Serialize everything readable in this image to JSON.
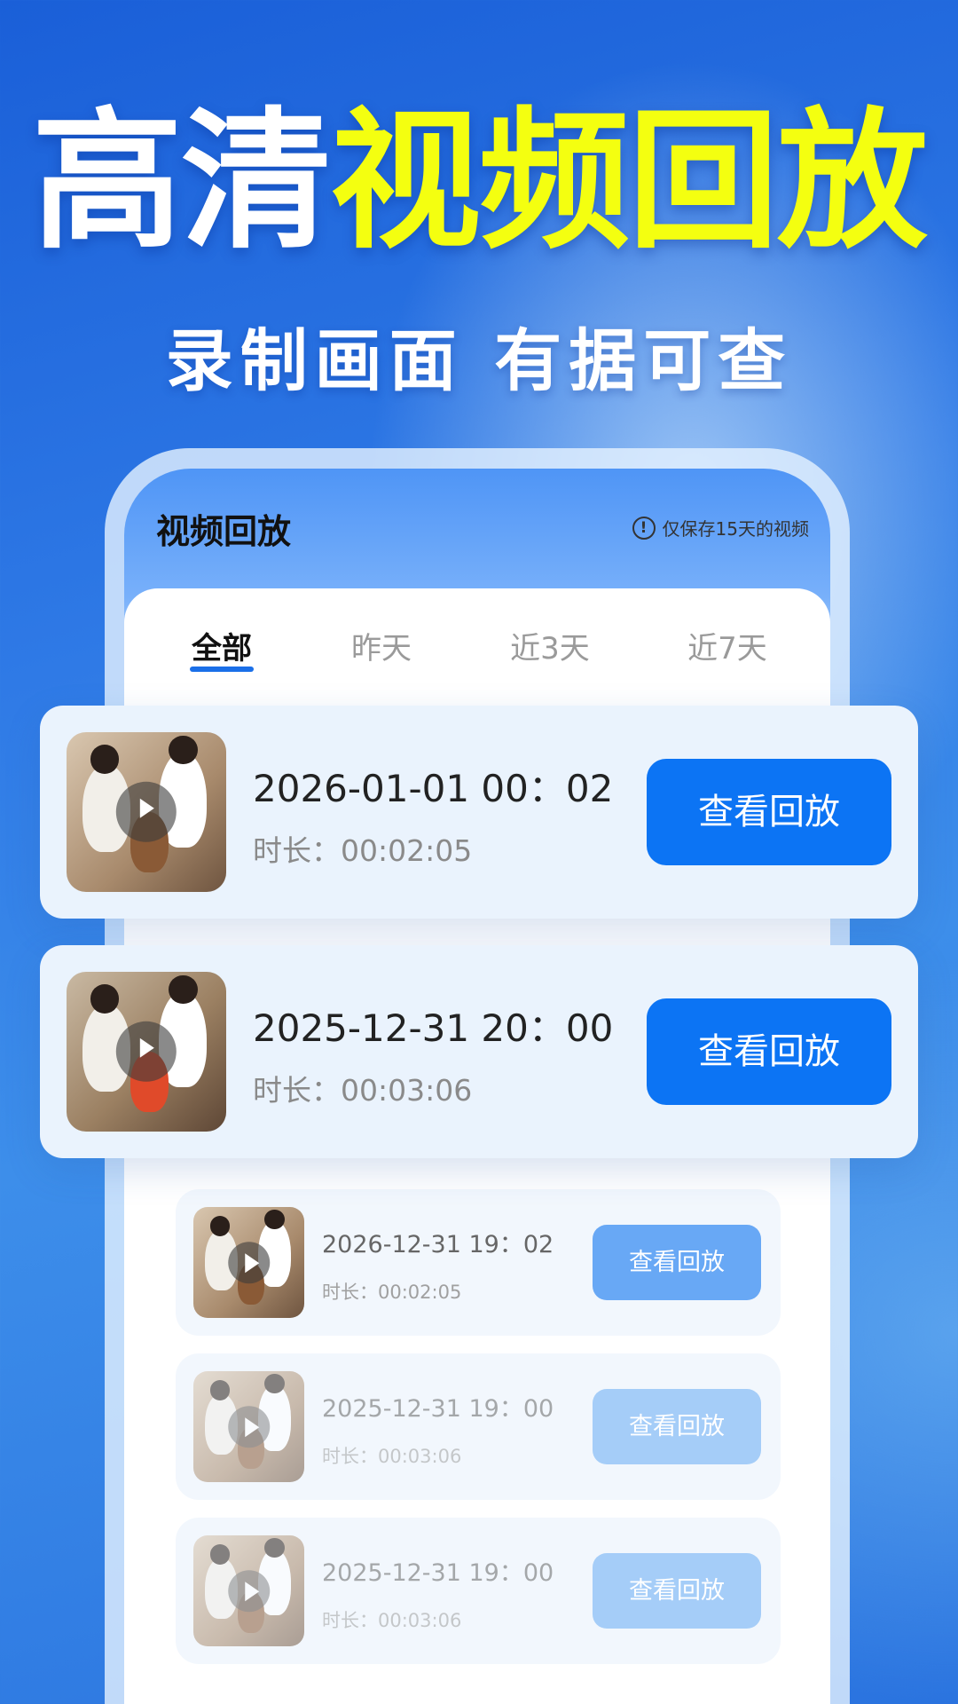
{
  "hero": {
    "title_white": "高清",
    "title_yellow": "视频回放",
    "subtitle": "录制画面 有据可查"
  },
  "screen": {
    "title": "视频回放",
    "note": "仅保存15天的视频",
    "note_icon": "info-icon"
  },
  "tabs": [
    {
      "label": "全部",
      "active": true
    },
    {
      "label": "昨天",
      "active": false
    },
    {
      "label": "近3天",
      "active": false
    },
    {
      "label": "近7天",
      "active": false
    }
  ],
  "recordings": [
    {
      "date": "2026-01-01  00：02",
      "duration": "时长：00:02:05",
      "button": "查看回放"
    },
    {
      "date": "2025-12-31  20：00",
      "duration": "时长：00:03:06",
      "button": "查看回放"
    },
    {
      "date": "2026-12-31  19：02",
      "duration": "时长：00:02:05",
      "button": "查看回放"
    },
    {
      "date": "2025-12-31  19：00",
      "duration": "时长：00:03:06",
      "button": "查看回放"
    },
    {
      "date": "2025-12-31  19：00",
      "duration": "时长：00:03:06",
      "button": "查看回放"
    }
  ],
  "colors": {
    "accent": "#0c74f4",
    "title_yellow": "#f4ff10",
    "background": "#2f7ae6"
  }
}
